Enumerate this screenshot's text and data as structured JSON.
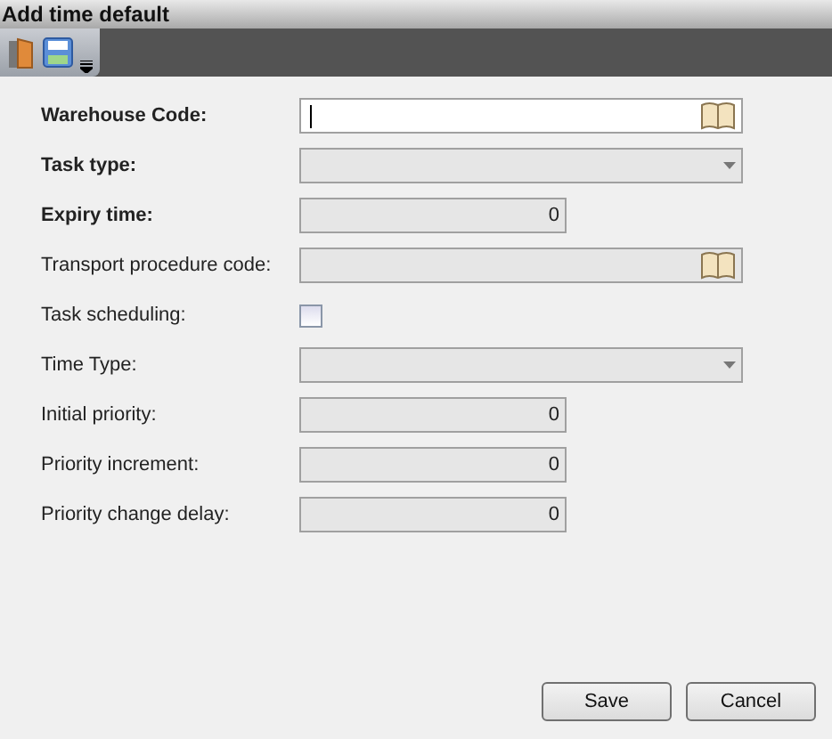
{
  "window": {
    "title": "Add time default"
  },
  "toolbar": {
    "buttons": [
      {
        "kind": "exit"
      },
      {
        "kind": "save"
      },
      {
        "kind": "more"
      }
    ]
  },
  "fields": [
    {
      "label": "Warehouse Code:",
      "kind": "lookup",
      "required": true,
      "disabled": false
    },
    {
      "label": "Task type:",
      "kind": "dropdown",
      "required": true,
      "disabled": true
    },
    {
      "label": "Expiry time:",
      "kind": "number",
      "required": true,
      "disabled": true,
      "value": "0"
    },
    {
      "label": "Transport procedure code:",
      "kind": "lookup",
      "required": false,
      "disabled": true
    },
    {
      "label": "Task scheduling:",
      "kind": "checkbox",
      "required": false,
      "checked": false
    },
    {
      "label": "Time Type:",
      "kind": "dropdown",
      "required": false,
      "disabled": true
    },
    {
      "label": "Initial priority:",
      "kind": "number",
      "required": false,
      "disabled": true,
      "value": "0"
    },
    {
      "label": "Priority increment:",
      "kind": "number",
      "required": false,
      "disabled": true,
      "value": "0"
    },
    {
      "label": "Priority change delay:",
      "kind": "number",
      "required": false,
      "disabled": true,
      "value": "0"
    }
  ],
  "buttons": [
    "Save",
    "Cancel"
  ]
}
